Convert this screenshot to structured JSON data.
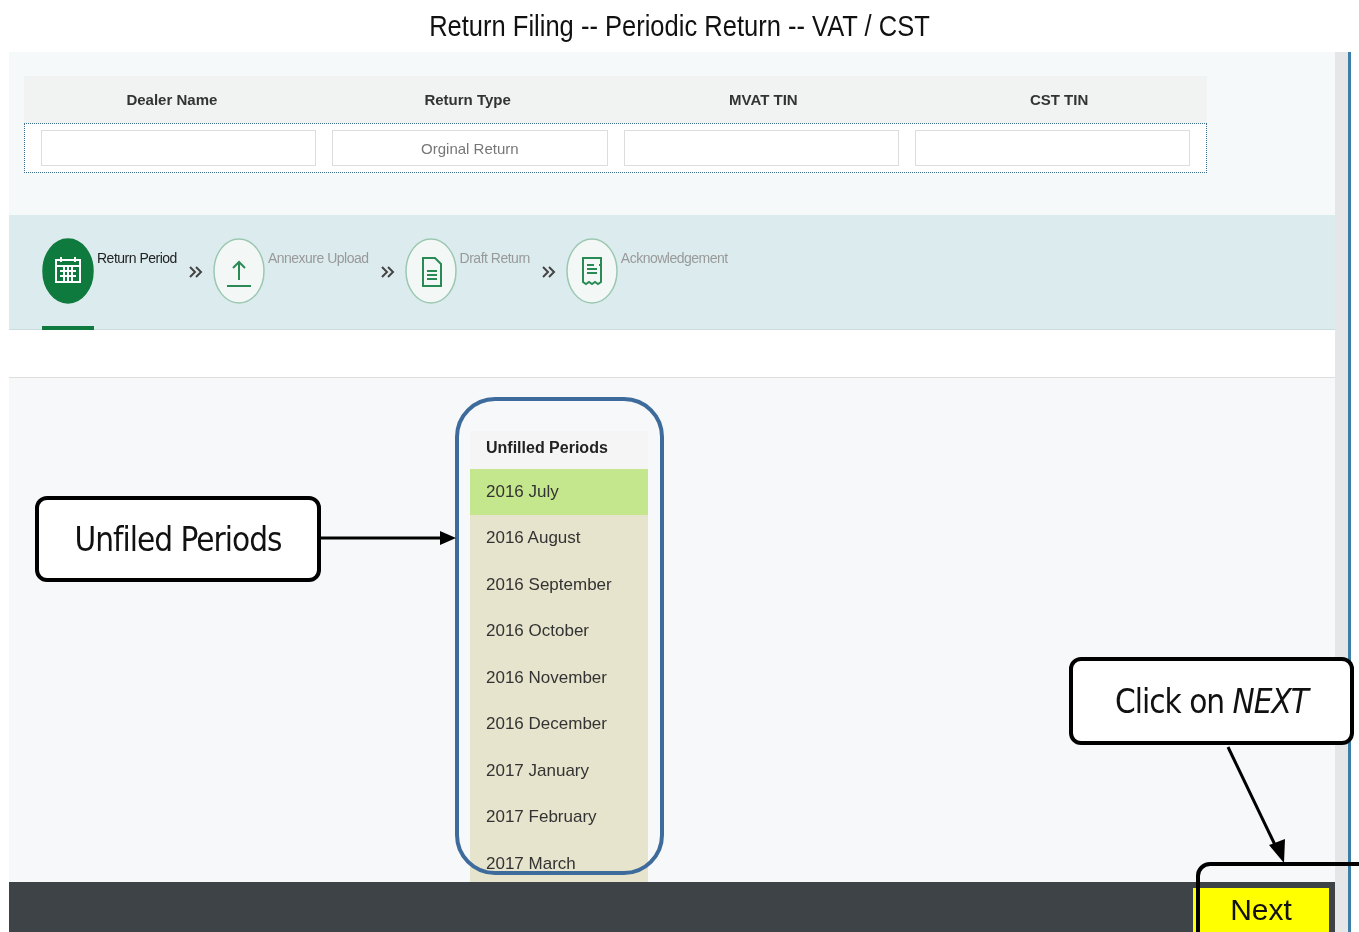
{
  "title": "Return Filing -- Periodic Return -- VAT / CST",
  "header": {
    "columns": [
      {
        "label": "Dealer Name"
      },
      {
        "label": "Return Type"
      },
      {
        "label": "MVAT TIN"
      },
      {
        "label": "CST TIN"
      }
    ],
    "fields": [
      {
        "kind": "empty"
      },
      {
        "kind": "text",
        "value": "Orginal Return"
      },
      {
        "kind": "empty"
      },
      {
        "kind": "empty"
      }
    ]
  },
  "steps": [
    {
      "label": "Return Period",
      "kind": "calendar",
      "selected": true
    },
    {
      "label": "Annexure Upload",
      "kind": "upload",
      "selected": false
    },
    {
      "label": "Draft Return",
      "kind": "document",
      "selected": false
    },
    {
      "label": "Acknowledgement",
      "kind": "receipt",
      "selected": false
    }
  ],
  "periods": {
    "heading": "Unfilled Periods",
    "items": [
      {
        "label": "2016 July",
        "selected": true
      },
      {
        "label": "2016 August",
        "selected": false
      },
      {
        "label": "2016 September",
        "selected": false
      },
      {
        "label": "2016 October",
        "selected": false
      },
      {
        "label": "2016 November",
        "selected": false
      },
      {
        "label": "2016 December",
        "selected": false
      },
      {
        "label": "2017 January",
        "selected": false
      },
      {
        "label": "2017 February",
        "selected": false
      },
      {
        "label": "2017 March",
        "selected": false
      }
    ]
  },
  "callouts": [
    {
      "text": "Unfiled Periods"
    },
    {
      "text": "Click on *NEXT*"
    }
  ],
  "footer": {
    "next_button": "Next"
  }
}
